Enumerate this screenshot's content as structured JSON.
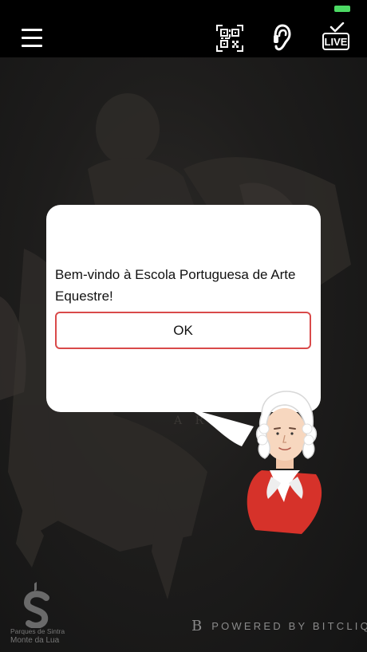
{
  "topbar": {
    "menu_icon": "hamburger-menu-icon",
    "qr_icon": "qr-code-scan-icon",
    "audio_icon": "audio-guide-icon",
    "live_label": "LIVE"
  },
  "dialog": {
    "message": "Bem-vindo à Escola Portuguesa de Arte Equestre!",
    "ok_label": "OK"
  },
  "footer": {
    "logo_line1": "Parques de Sintra",
    "logo_line2": "Monte da Lua",
    "powered_mark": "B",
    "powered_text": "POWERED BY BITCLIQ"
  },
  "colors": {
    "topbar_bg": "#000000",
    "battery": "#4cd964",
    "ok_border": "#d94a4a",
    "mascot_coat": "#d6322a"
  }
}
